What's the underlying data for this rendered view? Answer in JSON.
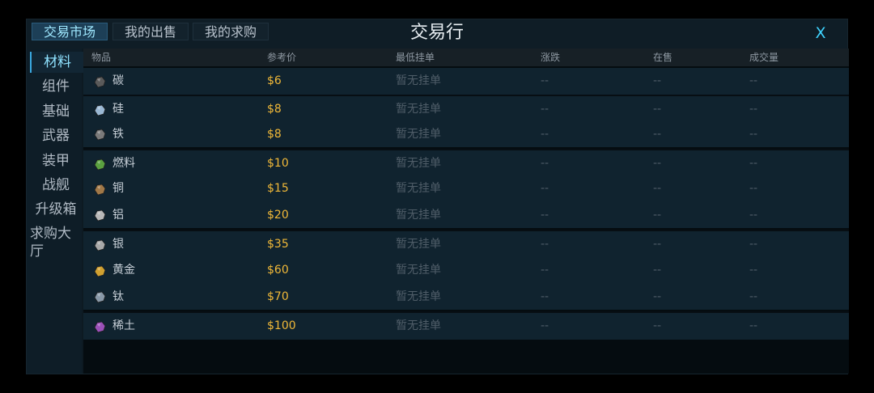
{
  "header": {
    "title": "交易行",
    "close_label": "X",
    "tabs": [
      {
        "label": "交易市场",
        "active": true
      },
      {
        "label": "我的出售",
        "active": false
      },
      {
        "label": "我的求购",
        "active": false
      }
    ]
  },
  "sidebar": {
    "items": [
      {
        "label": "材料",
        "active": true
      },
      {
        "label": "组件",
        "active": false
      },
      {
        "label": "基础",
        "active": false
      },
      {
        "label": "武器",
        "active": false
      },
      {
        "label": "装甲",
        "active": false
      },
      {
        "label": "战舰",
        "active": false
      },
      {
        "label": "升级箱",
        "active": false
      },
      {
        "label": "求购大厅",
        "active": false
      }
    ]
  },
  "table": {
    "columns": [
      "物品",
      "参考价",
      "最低挂单",
      "涨跌",
      "在售",
      "成交量"
    ],
    "rows": [
      {
        "name": "碳",
        "icon": "carbon-ore-icon",
        "color": "#5a5a5a",
        "price": "$6",
        "lowest": "暂无挂单",
        "change": "--",
        "on_sale": "--",
        "volume": "--"
      },
      {
        "name": "硅",
        "icon": "silicon-ore-icon",
        "color": "#9ab8d4",
        "price": "$8",
        "lowest": "暂无挂单",
        "change": "--",
        "on_sale": "--",
        "volume": "--"
      },
      {
        "name": "铁",
        "icon": "iron-ore-icon",
        "color": "#7a7a7a",
        "price": "$8",
        "lowest": "暂无挂单",
        "change": "--",
        "on_sale": "--",
        "volume": "--"
      },
      {
        "name": "燃料",
        "icon": "fuel-ore-icon",
        "color": "#5aa040",
        "price": "$10",
        "lowest": "暂无挂单",
        "change": "--",
        "on_sale": "--",
        "volume": "--"
      },
      {
        "name": "铜",
        "icon": "copper-ore-icon",
        "color": "#a07848",
        "price": "$15",
        "lowest": "暂无挂单",
        "change": "--",
        "on_sale": "--",
        "volume": "--"
      },
      {
        "name": "铝",
        "icon": "aluminum-ore-icon",
        "color": "#b8b8b8",
        "price": "$20",
        "lowest": "暂无挂单",
        "change": "--",
        "on_sale": "--",
        "volume": "--"
      },
      {
        "name": "银",
        "icon": "silver-ore-icon",
        "color": "#a8a8a8",
        "price": "$35",
        "lowest": "暂无挂单",
        "change": "--",
        "on_sale": "--",
        "volume": "--"
      },
      {
        "name": "黄金",
        "icon": "gold-ore-icon",
        "color": "#d0a030",
        "price": "$60",
        "lowest": "暂无挂单",
        "change": "--",
        "on_sale": "--",
        "volume": "--"
      },
      {
        "name": "钛",
        "icon": "titanium-ore-icon",
        "color": "#8898a8",
        "price": "$70",
        "lowest": "暂无挂单",
        "change": "--",
        "on_sale": "--",
        "volume": "--"
      },
      {
        "name": "稀土",
        "icon": "rare-earth-ore-icon",
        "color": "#9a50b8",
        "price": "$100",
        "lowest": "暂无挂单",
        "change": "--",
        "on_sale": "--",
        "volume": "--"
      }
    ]
  }
}
